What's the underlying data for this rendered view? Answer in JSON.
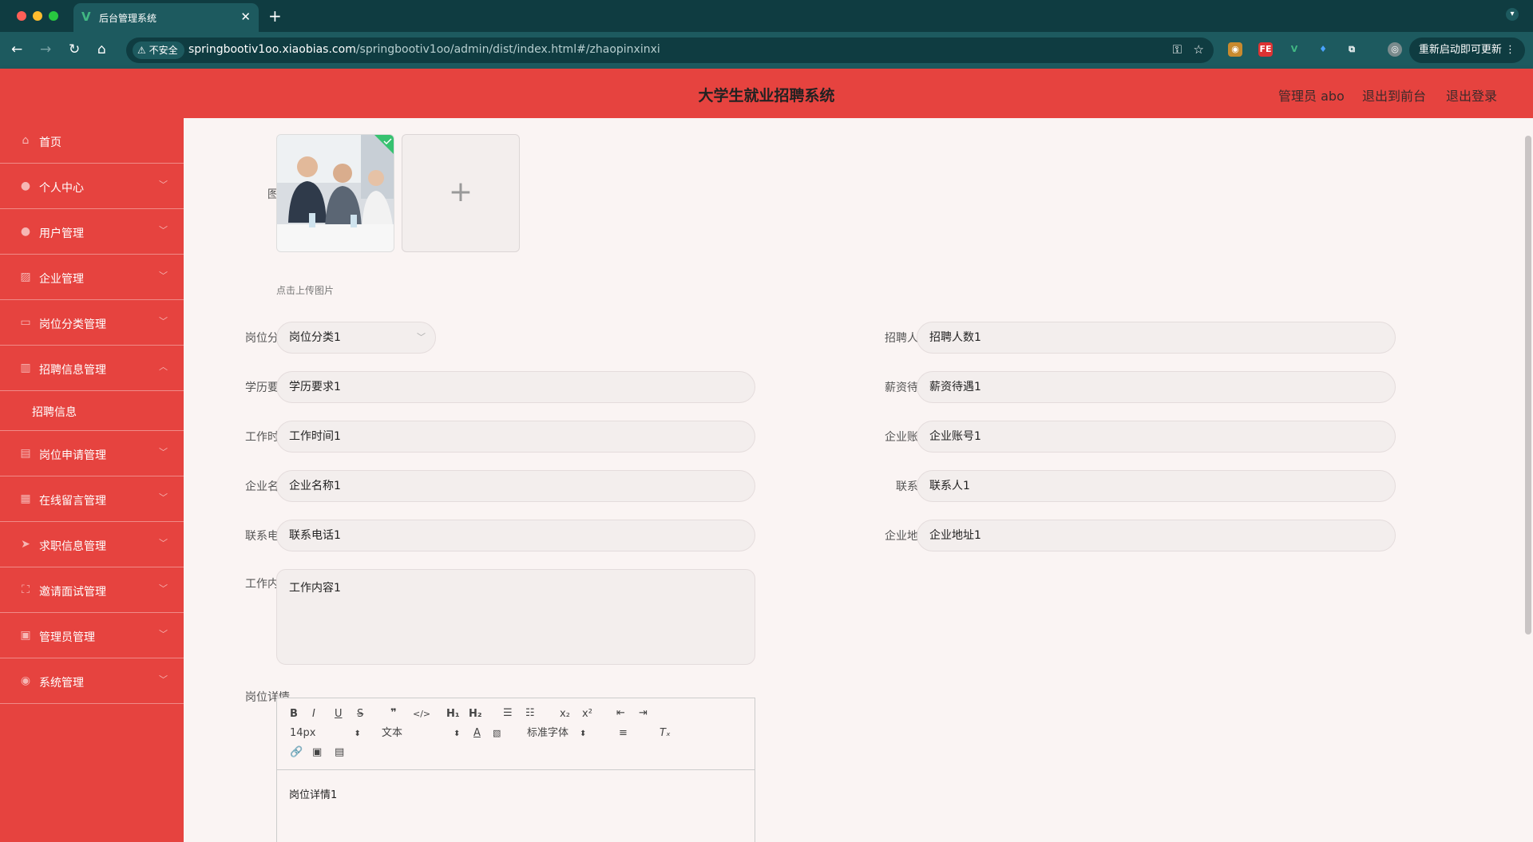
{
  "browser": {
    "tab_title": "后台管理系统",
    "url_host": "springbootiv1oo.xiaobias.com",
    "url_path": "/springbootiv1oo/admin/dist/index.html#/zhaopinxinxi",
    "insecure_label": "不安全",
    "relaunch_label": "重新启动即可更新"
  },
  "header": {
    "title": "大学生就业招聘系统",
    "user_label": "管理员 abo",
    "front_link": "退出到前台",
    "logout_link": "退出登录"
  },
  "sidebar": {
    "items": [
      {
        "label": "首页",
        "icon": "home-icon"
      },
      {
        "label": "个人中心",
        "icon": "user-icon"
      },
      {
        "label": "用户管理",
        "icon": "user-icon"
      },
      {
        "label": "企业管理",
        "icon": "chart-icon"
      },
      {
        "label": "岗位分类管理",
        "icon": "monitor-icon"
      },
      {
        "label": "招聘信息管理",
        "icon": "bar-chart-icon",
        "expanded": true
      },
      {
        "label": "岗位申请管理",
        "icon": "briefcase-icon"
      },
      {
        "label": "在线留言管理",
        "icon": "grid-icon"
      },
      {
        "label": "求职信息管理",
        "icon": "send-icon"
      },
      {
        "label": "邀请面试管理",
        "icon": "fullscreen-icon"
      },
      {
        "label": "管理员管理",
        "icon": "delete-icon"
      },
      {
        "label": "系统管理",
        "icon": "location-icon"
      }
    ],
    "subitem": "招聘信息"
  },
  "form": {
    "image_label": "图片",
    "upload_hint": "点击上传图片",
    "category_label": "岗位分类",
    "category_value": "岗位分类1",
    "headcount_label": "招聘人数",
    "headcount_value": "招聘人数1",
    "education_label": "学历要求",
    "education_value": "学历要求1",
    "salary_label": "薪资待遇",
    "salary_value": "薪资待遇1",
    "worktime_label": "工作时间",
    "worktime_value": "工作时间1",
    "account_label": "企业账号",
    "account_value": "企业账号1",
    "company_label": "企业名称",
    "company_value": "企业名称1",
    "contact_label": "联系人",
    "contact_value": "联系人1",
    "phone_label": "联系电话",
    "phone_value": "联系电话1",
    "address_label": "企业地址",
    "address_value": "企业地址1",
    "content_label": "工作内容",
    "content_value": "工作内容1",
    "detail_label": "岗位详情",
    "detail_value": "岗位详情1"
  },
  "editor": {
    "font_size": "14px",
    "text_type": "文本",
    "font_family": "标准字体"
  },
  "colors": {
    "brand_red": "#e6433f",
    "browser_teal": "#1d5a5f"
  }
}
